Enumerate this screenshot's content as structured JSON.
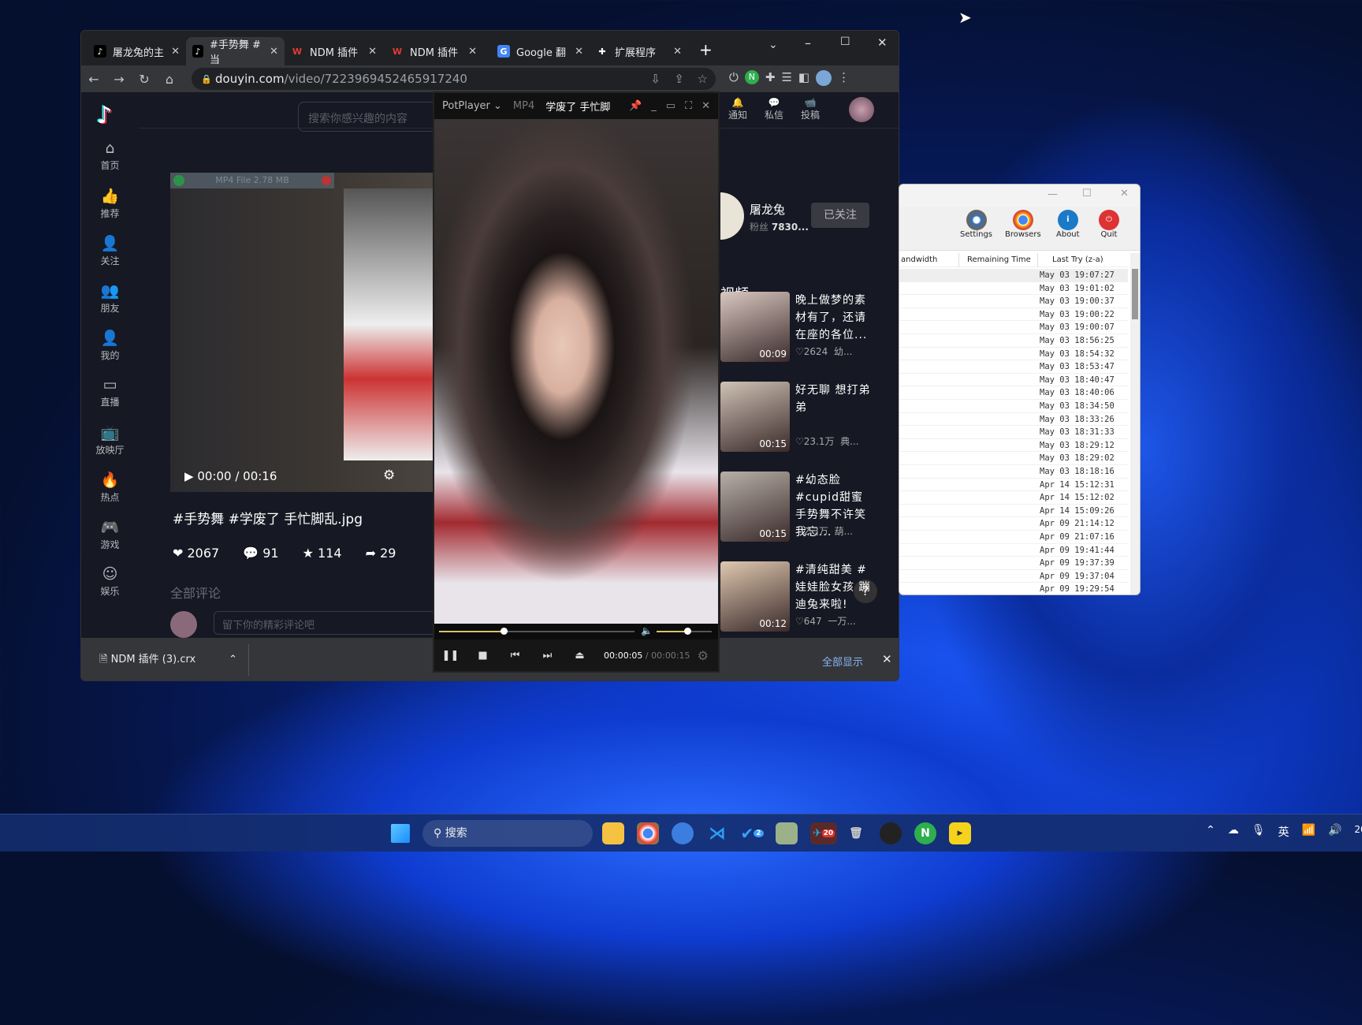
{
  "browser": {
    "tabs": [
      {
        "label": "屠龙兔的主",
        "icon": "tiktok-icon"
      },
      {
        "label": "#手势舞 #当",
        "icon": "tiktok-icon",
        "active": true
      },
      {
        "label": "NDM 插件",
        "icon": "ndm-icon"
      },
      {
        "label": "NDM 插件",
        "icon": "ndm-icon"
      },
      {
        "label": "Google 翻",
        "icon": "google-translate-icon"
      },
      {
        "label": "扩展程序",
        "icon": "puzzle-icon"
      }
    ],
    "url_domain": "douyin.com",
    "url_path": "/video/7223969452465917240",
    "download": {
      "file": "NDM 插件 (3).crx",
      "show_all": "全部显示"
    }
  },
  "douyin": {
    "search_placeholder": "搜索你感兴趣的内容",
    "sidebar": [
      "首页",
      "推荐",
      "关注",
      "朋友",
      "我的",
      "直播",
      "放映厅",
      "热点",
      "游戏",
      "娱乐"
    ],
    "header_icons": [
      "通知",
      "私信",
      "投稿"
    ],
    "ndm_bar": "MP4 File 2.78 MB",
    "player_time": "00:00 / 00:16",
    "video_title": "#手势舞  #学废了  手忙脚乱.jpg",
    "stats": {
      "likes": "2067",
      "comments": "91",
      "favorites": "114",
      "shares": "29"
    },
    "comments_heading": "全部评论",
    "comment_placeholder": "留下你的精彩评论吧",
    "author": {
      "name": "屠龙兔",
      "fans_label": "粉丝",
      "fans": "7830...",
      "follow": "已关注"
    },
    "videos_heading": "视频",
    "videos": [
      {
        "title": "晚上做梦的素材有了，还请在座的各位...",
        "duration": "00:09",
        "likes": "2624",
        "tag": "幼..."
      },
      {
        "title": "好无聊 想打弟弟",
        "duration": "00:15",
        "likes": "23.1万",
        "tag": "典..."
      },
      {
        "title": "#幼态脸 #cupid甜蜜手势舞不许笑我忘...",
        "duration": "00:15",
        "likes": "2.3万",
        "tag": "葫..."
      },
      {
        "title": "#清纯甜美 #娃娃脸女孩 蹦迪兔来啦!",
        "duration": "00:12",
        "likes": "647",
        "tag": "一万..."
      }
    ]
  },
  "potplayer": {
    "app": "PotPlayer",
    "format": "MP4",
    "title": "学废了 手忙脚",
    "current": "00:00:05",
    "total": "00:00:15",
    "progress": 0.33,
    "volume": 0.55
  },
  "ndm": {
    "toolbar": [
      "Settings",
      "Browsers",
      "About",
      "Quit"
    ],
    "columns": [
      "andwidth",
      "Remaining Time",
      "Last Try (z-a)"
    ],
    "rows": [
      "May 03  19:07:27",
      "May 03  19:01:02",
      "May 03  19:00:37",
      "May 03  19:00:22",
      "May 03  19:00:07",
      "May 03  18:56:25",
      "May 03  18:54:32",
      "May 03  18:53:47",
      "May 03  18:40:47",
      "May 03  18:40:06",
      "May 03  18:34:50",
      "May 03  18:33:26",
      "May 03  18:31:33",
      "May 03  18:29:12",
      "May 03  18:29:02",
      "May 03  18:18:16",
      "Apr 14  15:12:31",
      "Apr 14  15:12:02",
      "Apr 14  15:09:26",
      "Apr 09  21:14:12",
      "Apr 09  21:07:16",
      "Apr 09  19:41:44",
      "Apr 09  19:37:39",
      "Apr 09  19:37:04",
      "Apr 09  19:29:54"
    ]
  },
  "taskbar": {
    "search": "搜索",
    "telegram_badge": "20",
    "todo_badge": "2",
    "ime": "英",
    "clock_partial": "20"
  }
}
